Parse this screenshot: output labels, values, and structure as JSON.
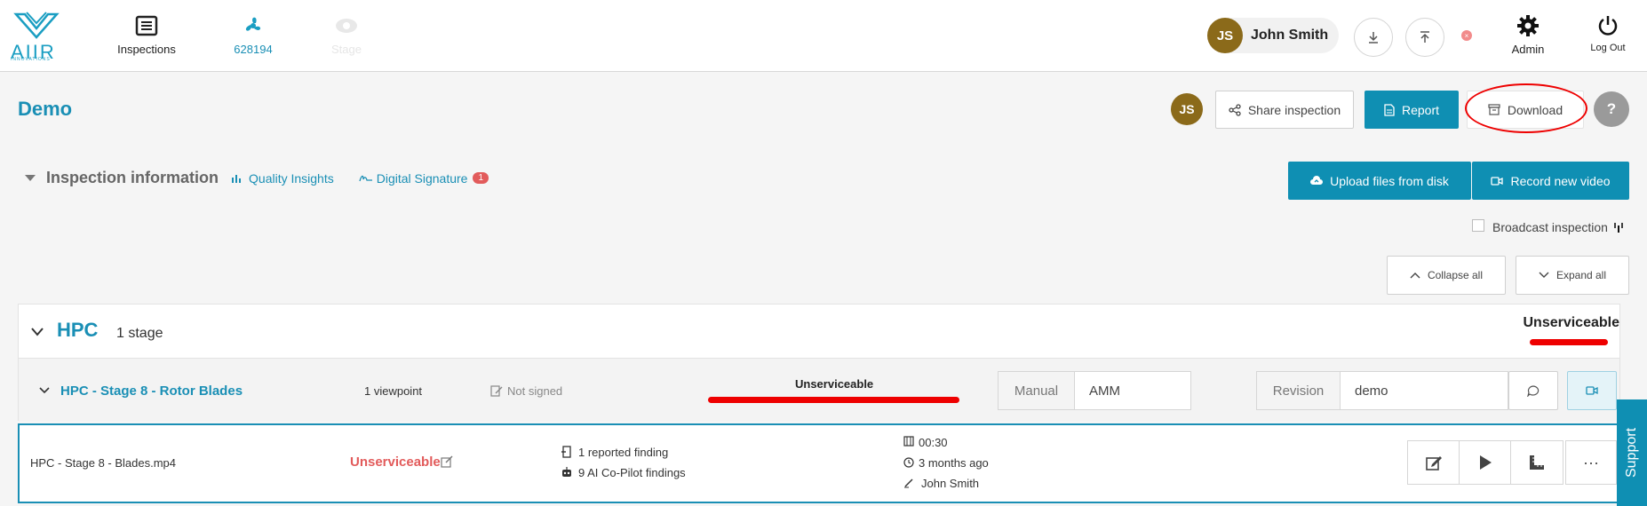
{
  "header": {
    "logo_text": "AIIR",
    "logo_sub": "INNOVATIONS",
    "nav": [
      {
        "label": "Inspections",
        "icon": "list-icon"
      },
      {
        "label": "628194",
        "icon": "fan-icon"
      },
      {
        "label": "Stage",
        "icon": "eye-icon"
      }
    ],
    "user": {
      "initials": "JS",
      "name": "John Smith"
    },
    "admin_label": "Admin",
    "logout_label": "Log Out"
  },
  "page": {
    "title": "Demo",
    "avatar_initials": "JS",
    "share_label": "Share inspection",
    "report_label": "Report",
    "download_label": "Download",
    "help_label": "?"
  },
  "inspection_info": {
    "title": "Inspection information",
    "quality_link": "Quality Insights",
    "signature_link": "Digital Signature",
    "signature_badge": "1",
    "upload_label": "Upload files from disk",
    "record_label": "Record new video",
    "broadcast_label": "Broadcast inspection",
    "collapse_label": "Collapse all",
    "expand_label": "Expand all"
  },
  "hpc": {
    "title": "HPC",
    "stage_count": "1 stage",
    "status": "Unserviceable"
  },
  "stage": {
    "title": "HPC - Stage 8 - Rotor Blades",
    "viewpoints": "1 viewpoint",
    "signed": "Not signed",
    "status": "Unserviceable",
    "manual_label": "Manual",
    "manual_value": "AMM",
    "revision_label": "Revision",
    "revision_value": "demo"
  },
  "video": {
    "filename": "HPC - Stage 8 - Blades.mp4",
    "status": "Unserviceable",
    "reported": "1 reported finding",
    "ai_findings": "9 AI Co-Pilot findings",
    "duration": "00:30",
    "age": "3 months ago",
    "author": "John Smith"
  },
  "support_label": "Support",
  "colors": {
    "accent": "#0f8fb3",
    "danger": "#e25b5b",
    "avatar": "#8b6a1a",
    "annotation": "#ee0000"
  }
}
